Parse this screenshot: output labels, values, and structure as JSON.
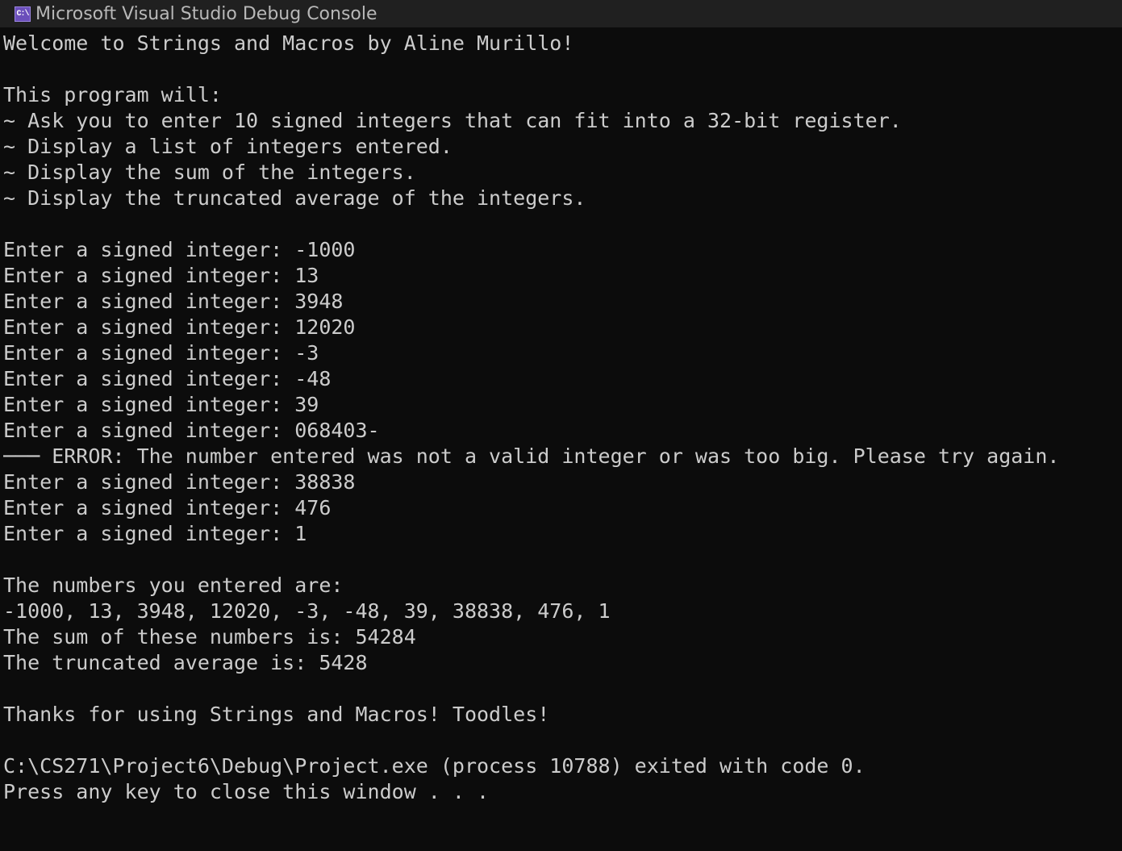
{
  "window": {
    "icon_text": "C:\\",
    "title": "Microsoft Visual Studio Debug Console"
  },
  "console": {
    "lines": [
      "Welcome to Strings and Macros by Aline Murillo!",
      "",
      "This program will:",
      "~ Ask you to enter 10 signed integers that can fit into a 32-bit register.",
      "~ Display a list of integers entered.",
      "~ Display the sum of the integers.",
      "~ Display the truncated average of the integers.",
      "",
      "Enter a signed integer: -1000",
      "Enter a signed integer: 13",
      "Enter a signed integer: 3948",
      "Enter a signed integer: 12020",
      "Enter a signed integer: -3",
      "Enter a signed integer: -48",
      "Enter a signed integer: 39",
      "Enter a signed integer: 068403-",
      "─── ERROR: The number entered was not a valid integer or was too big. Please try again.",
      "Enter a signed integer: 38838",
      "Enter a signed integer: 476",
      "Enter a signed integer: 1",
      "",
      "The numbers you entered are:",
      "-1000, 13, 3948, 12020, -3, -48, 39, 38838, 476, 1",
      "The sum of these numbers is: 54284",
      "The truncated average is: 5428",
      "",
      "Thanks for using Strings and Macros! Toodles!",
      "",
      "C:\\CS271\\Project6\\Debug\\Project.exe (process 10788) exited with code 0.",
      "Press any key to close this window . . ."
    ]
  },
  "colors": {
    "background": "#0c0c0c",
    "titlebar": "#202020",
    "text": "#cccccc",
    "icon": "#6b4fbb"
  }
}
